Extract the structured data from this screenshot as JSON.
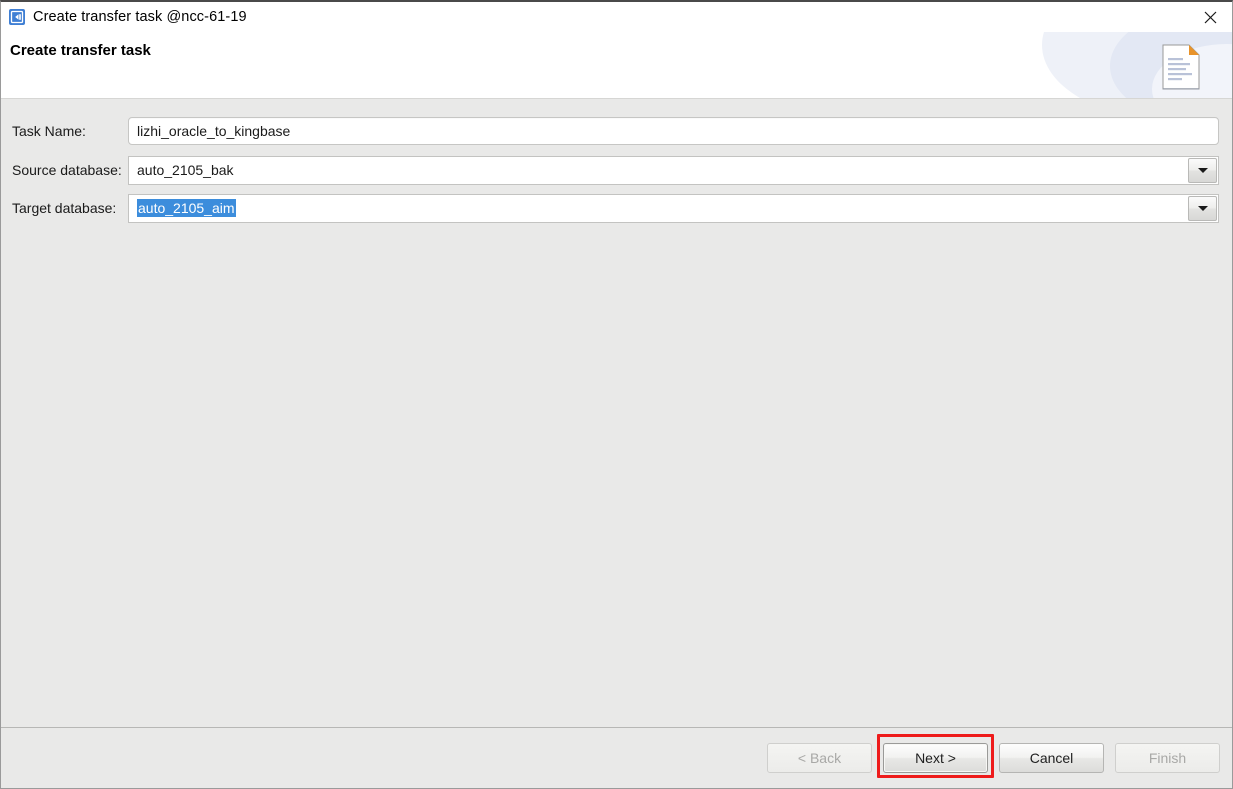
{
  "window": {
    "titlebar": {
      "icon": "transfer-app-icon",
      "title": "Create transfer task @ncc-61-19",
      "close_label": "✕"
    },
    "header": {
      "heading": "Create transfer task",
      "graphic": "document-page-icon"
    }
  },
  "form": {
    "fields": [
      {
        "label": "Task Name:",
        "type": "text",
        "value": "lizhi_oracle_to_kingbase",
        "placeholder": "",
        "selected": false
      },
      {
        "label": "Source database:",
        "type": "combo",
        "value": "auto_2105_bak",
        "placeholder": "",
        "selected": false,
        "dropdown_icon": "chevron-down-icon"
      },
      {
        "label": "Target database:",
        "type": "combo",
        "value": "auto_2105_aim",
        "placeholder": "",
        "selected": true,
        "dropdown_icon": "chevron-down-icon"
      }
    ]
  },
  "footer": {
    "buttons": [
      {
        "label": "< Back",
        "state": "disabled"
      },
      {
        "label": "Next >",
        "state": "focused"
      },
      {
        "label": "Cancel",
        "state": "enabled"
      },
      {
        "label": "Finish",
        "state": "disabled"
      }
    ]
  },
  "colors": {
    "selection_blue": "#3c8ddc",
    "annotation_red": "#ee1b1b",
    "body_background": "#e9e9e8",
    "header_background": "#ffffff",
    "icon_blue": "#3f7fd4",
    "doc_fold_orange": "#f0a336"
  }
}
